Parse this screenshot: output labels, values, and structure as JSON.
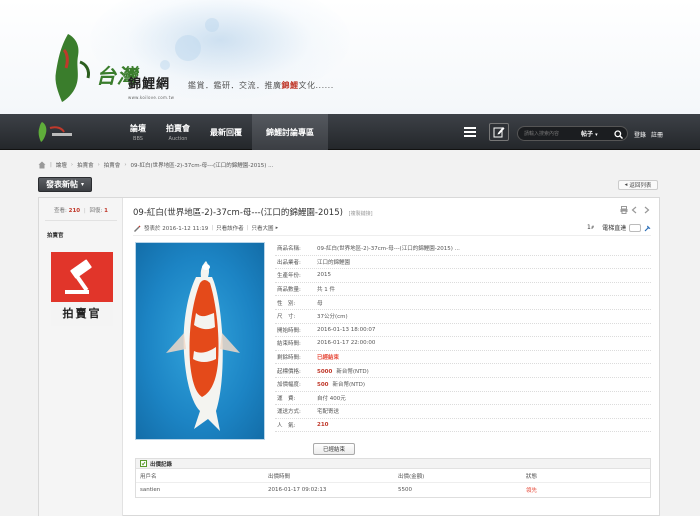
{
  "banner": {
    "logo_title": "錦鯉網",
    "logo_sub": "www.koilove.com.tw",
    "slogan_prefix": "鑑賞．鑑研．交流．推廣",
    "slogan_highlight": "錦鯉",
    "slogan_suffix": "文化......"
  },
  "nav": {
    "items": [
      {
        "title": "論壇",
        "sub": "BBS"
      },
      {
        "title": "拍賣會",
        "sub": "Auction"
      },
      {
        "title": "最新回覆",
        "sub": ""
      },
      {
        "title": "錦鯉討論專區",
        "sub": ""
      }
    ],
    "search_placeholder": "請輸入搜索內容",
    "search_type": "帖子",
    "login": "登錄",
    "register": "註冊"
  },
  "breadcrumb": [
    "論壇",
    "拍賣會",
    "拍賣會",
    "09-紅白(世界地區-2)-37cm-母---(江口的錦鯉園-2015) ..."
  ],
  "actions": {
    "new_post": "發表新帖",
    "back": "返回列表"
  },
  "sidebar": {
    "views_label": "查看:",
    "views": "210",
    "sep": "|",
    "replies_label": "回復:",
    "replies": "1",
    "user": "拍賣官",
    "avatar_text": "拍賣官"
  },
  "post": {
    "title": "09-紅白(世界地區-2)-37cm-母---(江口的錦鯉園-2015)",
    "title_tag": "[複製鏈接]",
    "posted_at": "發表於 2016-1-12 11:19",
    "only_author": "只看該作者",
    "only_big_image": "只看大圖",
    "floor_num": "1",
    "floor_sup": "#",
    "floor_label": "電梯直達"
  },
  "info": [
    {
      "label": "商品名稱:",
      "value": "09-紅白(世界地區-2)-37cm-母---(江口的錦鯉園-2015) ..."
    },
    {
      "label": "出品業者:",
      "value": "江口的錦鯉園"
    },
    {
      "label": "生產年份:",
      "value": "2015"
    },
    {
      "label": "商品數量:",
      "value": "共 1 件"
    },
    {
      "label": "性　別:",
      "value": "母"
    },
    {
      "label": "尺　寸:",
      "value": "37公分(cm)"
    },
    {
      "label": "開始時間:",
      "value": "2016-01-13 18:00:07"
    },
    {
      "label": "結束時間:",
      "value": "2016-01-17 22:00:00"
    },
    {
      "label": "剩餘時間:",
      "value": "已經結束",
      "red": true
    },
    {
      "label": "起標價格:",
      "num": "5000",
      "value": "新台幣(NTD)"
    },
    {
      "label": "加價幅度:",
      "num": "500",
      "value": "新台幣(NTD)"
    },
    {
      "label": "運　費:",
      "value": "自付 400元"
    },
    {
      "label": "運送方式:",
      "value": "宅配寄送"
    },
    {
      "label": "人　氣:",
      "num": "210",
      "value": ""
    }
  ],
  "ended_button": "已經結束",
  "bids": {
    "title": "出價記錄",
    "columns": [
      "用戶名",
      "出價時間",
      "出價(金額)",
      "狀態"
    ],
    "rows": [
      [
        "santien",
        "2016-01-17 09:02:13",
        "5500",
        "領先"
      ]
    ]
  },
  "colors": {
    "accent_red": "#e74c3c",
    "nav_dark": "#2b2e32",
    "koi_water": "#1c84c4"
  }
}
